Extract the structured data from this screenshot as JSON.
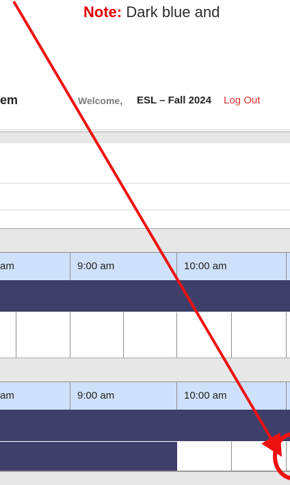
{
  "note": {
    "label": "Note:",
    "text": " Dark blue and"
  },
  "header": {
    "title_fragment": "em",
    "welcome": "Welcome,",
    "term": "ESL – Fall 2024",
    "logout": "Log Out"
  },
  "schedule": {
    "times": [
      "am",
      "9:00 am",
      "10:00 am"
    ]
  },
  "colors": {
    "accent_red": "#e00000",
    "header_blue": "#cfe1fa",
    "band_dark_blue": "#3f3f6b",
    "gray_bar": "#e7e7e7"
  }
}
